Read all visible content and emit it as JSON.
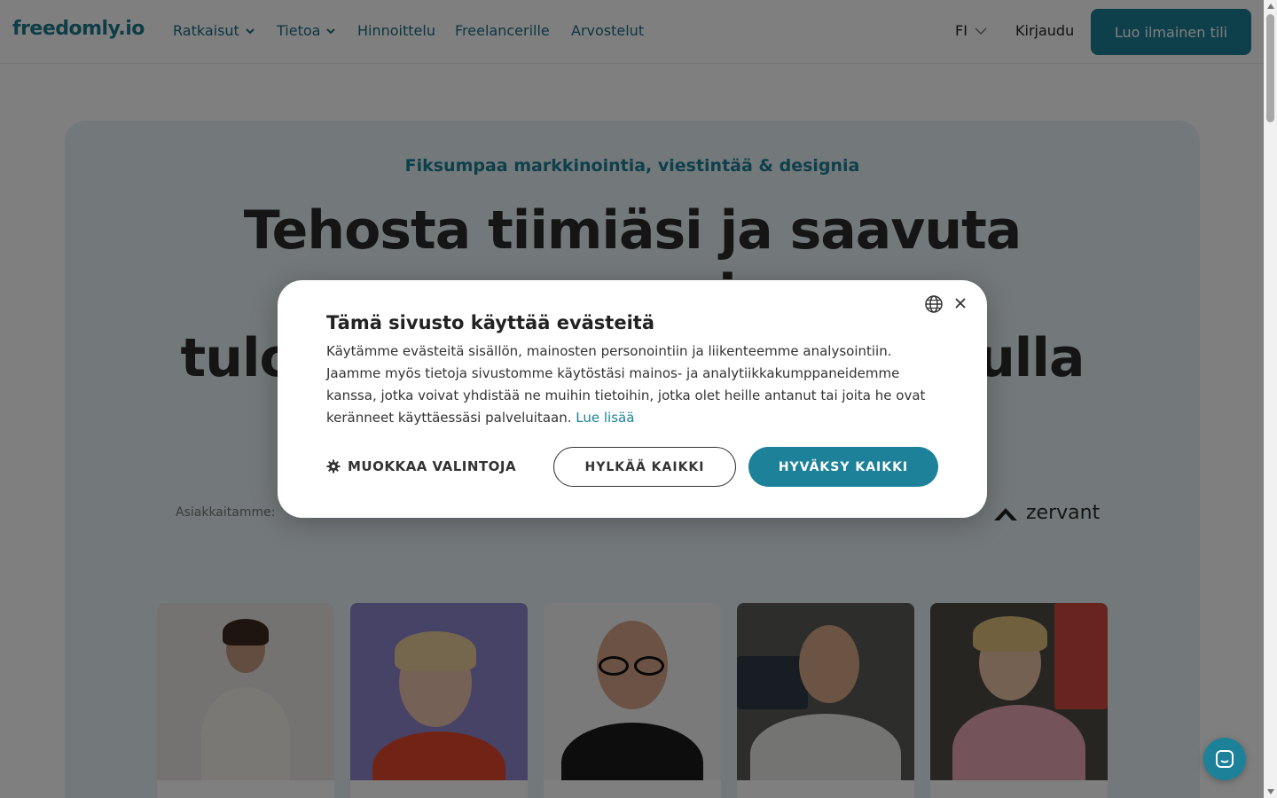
{
  "nav": {
    "logo": "freedomly.io",
    "items": [
      {
        "label": "Ratkaisut",
        "has_dropdown": true
      },
      {
        "label": "Tietoa",
        "has_dropdown": true
      },
      {
        "label": "Hinnoittelu",
        "has_dropdown": false
      },
      {
        "label": "Freelancerille",
        "has_dropdown": false
      },
      {
        "label": "Arvostelut",
        "has_dropdown": false
      }
    ],
    "language": "FI",
    "login": "Kirjaudu",
    "cta": "Luo ilmainen tili"
  },
  "hero": {
    "eyebrow": "Fiksumpaa markkinointia, viestintää & designia",
    "headline_line1": "Tehosta tiimiäsi ja saavuta parempia",
    "headline_line2": "tuloksia freelancereiden avulla",
    "clients_label": "Asiakkaitamme:",
    "client_logo_zervant": "zervant"
  },
  "cookie_modal": {
    "title": "Tämä sivusto käyttää evästeitä",
    "body": "Käytämme evästeitä sisällön, mainosten personointiin ja liikenteemme analysointiin. Jaamme myös tietoja sivustomme käytöstäsi mainos- ja analytiikkakumppaneidemme kanssa, jotka voivat yhdistää ne muihin tietoihin, jotka olet heille antanut tai joita he ovat keränneet käyttäessäsi palveluitaan.",
    "read_more": "Lue lisää",
    "customize": "MUOKKAA VALINTOJA",
    "reject": "HYLKÄÄ KAIKKI",
    "accept": "HYVÄKSY KAIKKI"
  },
  "colors": {
    "brand": "#1c8199",
    "overlay": "rgba(0,0,0,0.5)",
    "hero_bg": "#e6f0f4"
  },
  "icons": [
    "chevron-down-icon",
    "globe-icon",
    "close-icon",
    "gear-icon",
    "chat-icon"
  ]
}
